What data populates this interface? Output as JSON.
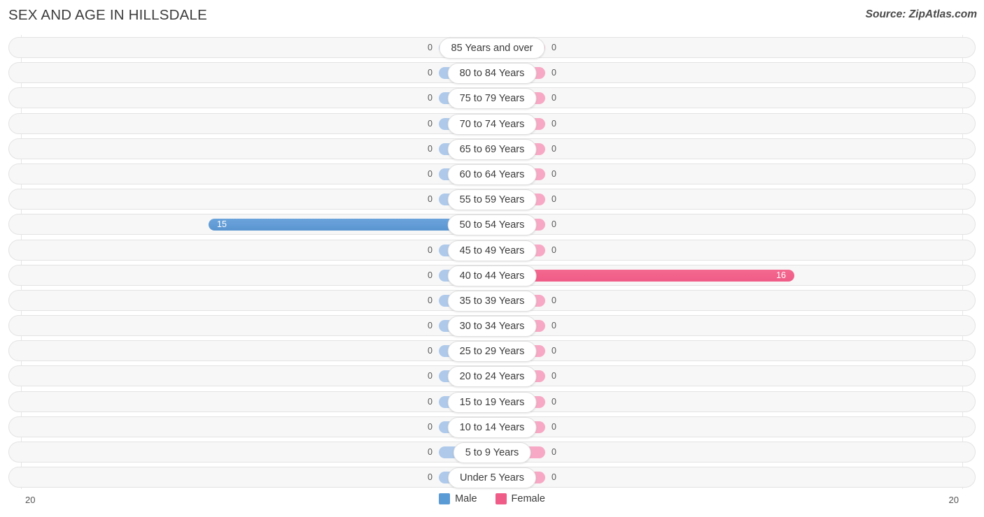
{
  "header": {
    "title": "SEX AND AGE IN HILLSDALE",
    "source": "Source: ZipAtlas.com"
  },
  "legend": {
    "male_label": "Male",
    "female_label": "Female"
  },
  "axis": {
    "left_max_label": "20",
    "right_max_label": "20"
  },
  "colors": {
    "male": "#5b9bd5",
    "male_muted": "#aec9ea",
    "female": "#ef5c87",
    "female_muted": "#f7a8c4",
    "row_background": "#f7f7f7",
    "row_border": "#e3e3e3"
  },
  "chart_data": {
    "type": "bar",
    "title": "SEX AND AGE IN HILLSDALE",
    "xlabel": "",
    "ylabel": "",
    "xlim": [
      20,
      20
    ],
    "grid": true,
    "legend_position": "bottom-center",
    "orientation": "horizontal-diverging",
    "categories": [
      "85 Years and over",
      "80 to 84 Years",
      "75 to 79 Years",
      "70 to 74 Years",
      "65 to 69 Years",
      "60 to 64 Years",
      "55 to 59 Years",
      "50 to 54 Years",
      "45 to 49 Years",
      "40 to 44 Years",
      "35 to 39 Years",
      "30 to 34 Years",
      "25 to 29 Years",
      "20 to 24 Years",
      "15 to 19 Years",
      "10 to 14 Years",
      "5 to 9 Years",
      "Under 5 Years"
    ],
    "series": [
      {
        "name": "Male",
        "values": [
          0,
          0,
          0,
          0,
          0,
          0,
          0,
          15,
          0,
          0,
          0,
          0,
          0,
          0,
          0,
          0,
          0,
          0
        ]
      },
      {
        "name": "Female",
        "values": [
          0,
          0,
          0,
          0,
          0,
          0,
          0,
          0,
          0,
          16,
          0,
          0,
          0,
          0,
          0,
          0,
          0,
          0
        ]
      }
    ]
  },
  "rows": [
    {
      "age": "85 Years and over",
      "male": "0",
      "female": "0"
    },
    {
      "age": "80 to 84 Years",
      "male": "0",
      "female": "0"
    },
    {
      "age": "75 to 79 Years",
      "male": "0",
      "female": "0"
    },
    {
      "age": "70 to 74 Years",
      "male": "0",
      "female": "0"
    },
    {
      "age": "65 to 69 Years",
      "male": "0",
      "female": "0"
    },
    {
      "age": "60 to 64 Years",
      "male": "0",
      "female": "0"
    },
    {
      "age": "55 to 59 Years",
      "male": "0",
      "female": "0"
    },
    {
      "age": "50 to 54 Years",
      "male": "15",
      "female": "0"
    },
    {
      "age": "45 to 49 Years",
      "male": "0",
      "female": "0"
    },
    {
      "age": "40 to 44 Years",
      "male": "0",
      "female": "16"
    },
    {
      "age": "35 to 39 Years",
      "male": "0",
      "female": "0"
    },
    {
      "age": "30 to 34 Years",
      "male": "0",
      "female": "0"
    },
    {
      "age": "25 to 29 Years",
      "male": "0",
      "female": "0"
    },
    {
      "age": "20 to 24 Years",
      "male": "0",
      "female": "0"
    },
    {
      "age": "15 to 19 Years",
      "male": "0",
      "female": "0"
    },
    {
      "age": "10 to 14 Years",
      "male": "0",
      "female": "0"
    },
    {
      "age": "5 to 9 Years",
      "male": "0",
      "female": "0"
    },
    {
      "age": "Under 5 Years",
      "male": "0",
      "female": "0"
    }
  ]
}
